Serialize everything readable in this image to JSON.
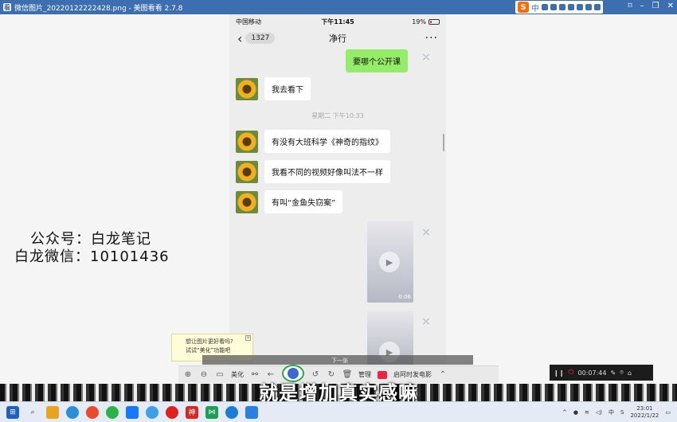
{
  "window": {
    "title": "微信图片_20220122222428.png - 美图看看 2.7.8"
  },
  "ime": {
    "label": "中"
  },
  "phone": {
    "carrier": "中国移动",
    "time": "下午11:45",
    "battery": "19%",
    "back_count": "1327",
    "chat_title": "净行",
    "more": "···",
    "timestamp": "星期二 下午10:33",
    "messages": [
      {
        "text": "要哪个公开课"
      },
      {
        "text": "我去看下"
      },
      {
        "text": "有没有大班科学《神奇的指纹》"
      },
      {
        "text": "我看不同的视频好像叫法不一样"
      },
      {
        "text": "有叫“金鱼失窃案”"
      }
    ],
    "video_duration": "0:06"
  },
  "overlay": {
    "line1": "公众号：白龙笔记",
    "line2": "白龙微信：10101436"
  },
  "tooltip": {
    "line1": "想让图片更好看吗?",
    "line2": "试试“美化”功能吧"
  },
  "viewer": {
    "page_label": "下一张",
    "beautify": "美化",
    "manage": "管理",
    "make_video": "启阿时发电影"
  },
  "recorder": {
    "time": "00:07:44"
  },
  "subtitle": "就是增加真实感嘛",
  "taskbar": {
    "time": "23:01",
    "date": "2022/1/22",
    "ime_tray": "中"
  },
  "colors": {
    "titlebar": "#3d6fb0",
    "wechat_green": "#95ec69",
    "taskbar": "#e5ebf4"
  }
}
